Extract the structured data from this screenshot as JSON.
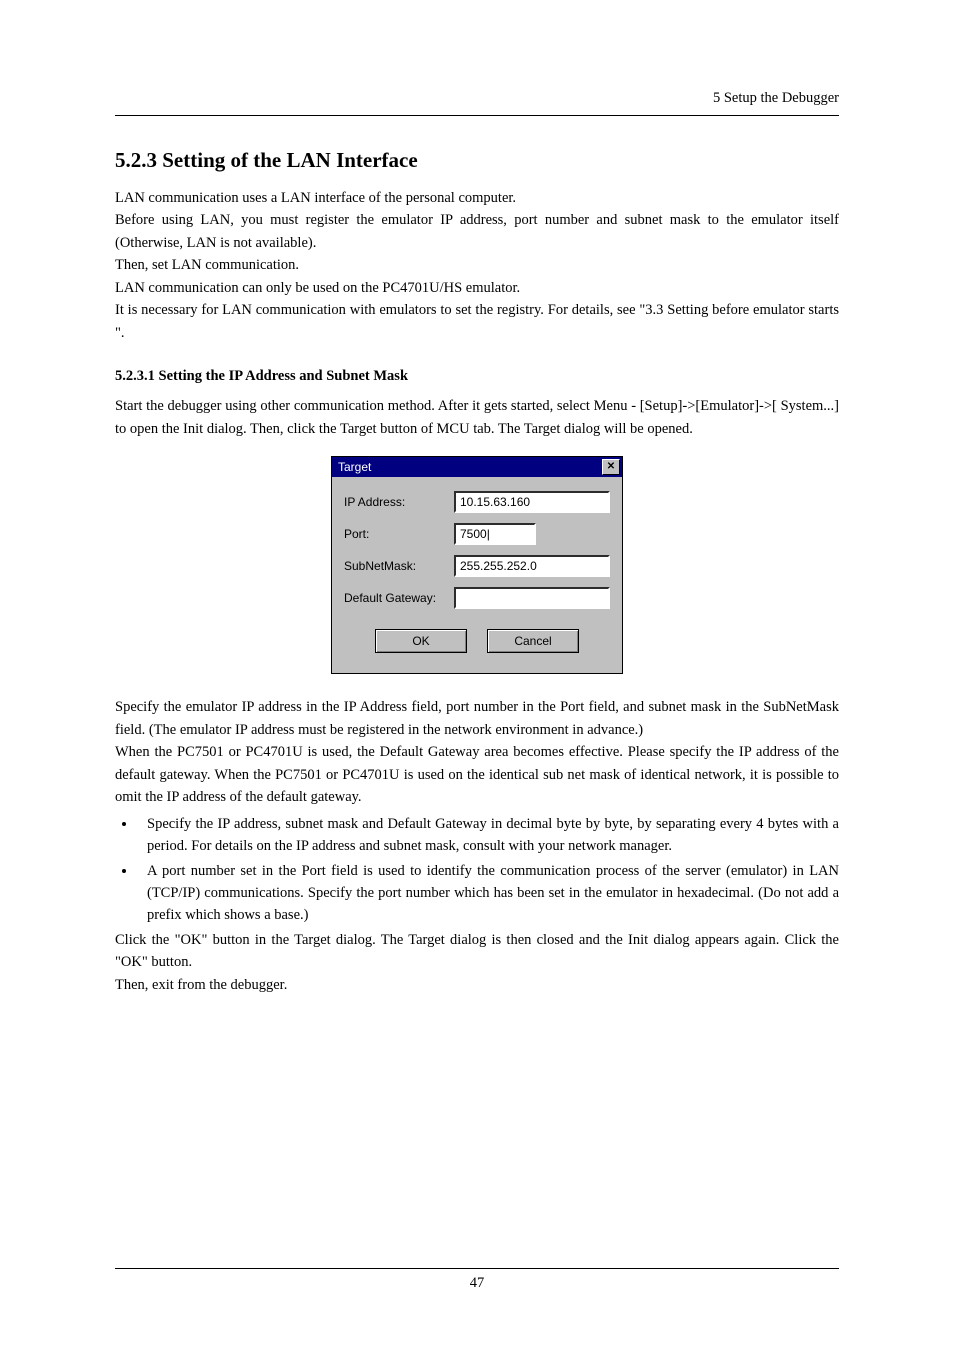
{
  "header": {
    "right": "5 Setup the Debugger"
  },
  "section": {
    "title": "5.2.3 Setting of the LAN Interface"
  },
  "intro": {
    "p1": "LAN communication uses a LAN interface of the personal computer.",
    "p2": "Before using LAN, you must register the emulator IP address, port number and subnet mask to the emulator itself (Otherwise, LAN is not available).",
    "p3": "Then, set LAN communication.",
    "p4": "LAN communication can only be used on the PC4701U/HS emulator.",
    "p5": "It is necessary for LAN communication with emulators to set the registry. For details, see \"3.3 Setting before emulator starts \"."
  },
  "sub": {
    "title": "5.2.3.1 Setting the IP Address and Subnet Mask",
    "p1": "Start the debugger using other communication method. After it gets started, select Menu - [Setup]->[Emulator]->[ System...] to open the Init dialog. Then, click the Target button of MCU tab. The Target dialog will be opened."
  },
  "dialog": {
    "title": "Target",
    "labels": {
      "ip": "IP Address:",
      "port": "Port:",
      "subnet": "SubNetMask:",
      "gateway": "Default Gateway:"
    },
    "values": {
      "ip": "10.15.63.160",
      "port": "7500|",
      "subnet": "255.255.252.0",
      "gateway": ""
    },
    "buttons": {
      "ok": "OK",
      "cancel": "Cancel"
    }
  },
  "after": {
    "p1": "Specify the emulator IP address in the IP Address field, port number in the Port field, and subnet mask in the SubNetMask field. (The emulator IP address must be registered in the network environment in advance.)",
    "p2": "When the PC7501 or PC4701U is used, the Default Gateway area becomes effective. Please specify the IP address of the default gateway. When the PC7501 or PC4701U is used on the identical sub net mask of identical network, it is possible to omit the IP address of the default gateway.",
    "b1": "Specify the IP address, subnet mask and Default Gateway in decimal byte by byte, by separating every 4 bytes with a period. For details on the IP address and subnet mask, consult with your network manager.",
    "b2": "A port number set in the Port field is used to identify the communication process of the server (emulator) in LAN (TCP/IP) communications. Specify the port number which has been set in the emulator in hexadecimal. (Do not add a prefix which shows a base.)",
    "p3": "Click the \"OK\" button in the Target dialog. The Target dialog is then closed and the Init dialog appears again. Click the \"OK\" button.",
    "p4": "Then, exit from the debugger."
  },
  "footer": {
    "page": "47"
  }
}
